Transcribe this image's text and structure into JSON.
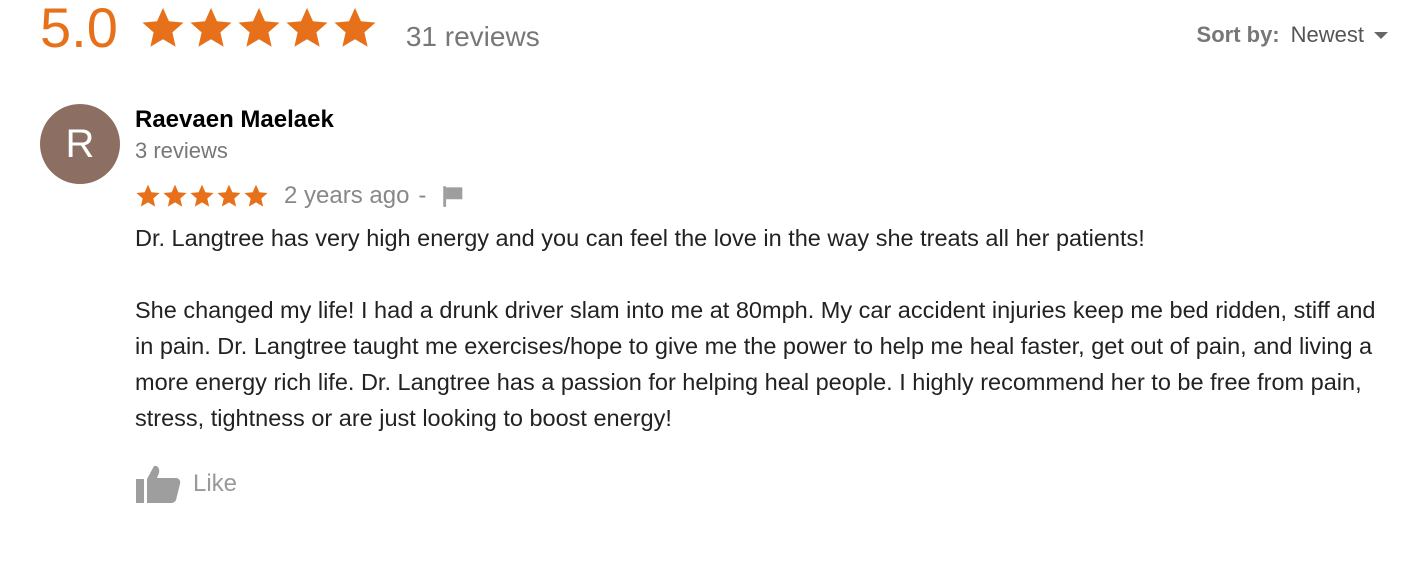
{
  "summary": {
    "rating": "5.0",
    "stars": 5,
    "review_count": "31 reviews"
  },
  "sort": {
    "label": "Sort by:",
    "value": "Newest"
  },
  "review": {
    "avatar_initial": "R",
    "reviewer_name": "Raevaen Maelaek",
    "reviewer_reviews": "3 reviews",
    "stars": 5,
    "time_ago": "2 years ago",
    "separator": "-",
    "paragraphs": [
      "Dr. Langtree has very high energy and you can feel the love in the way she treats all her patients!",
      "She changed my life!  I had a drunk driver slam into me at 80mph. My car accident injuries keep me bed ridden, stiff and in pain. Dr. Langtree taught me exercises/hope to give me the power to help me heal faster, get out of pain, and living a more energy rich life.  Dr. Langtree has a passion for helping heal people. I highly recommend her to be free from pain, stress, tightness or are just looking to boost energy!"
    ],
    "like_label": "Like"
  },
  "colors": {
    "star": "#e7711b",
    "avatar": "#8d6e63",
    "muted_text": "#777777"
  },
  "icons": {
    "star": "star-icon",
    "flag": "flag-icon",
    "like": "thumbs-up-icon",
    "sort": "caret-down-icon"
  }
}
